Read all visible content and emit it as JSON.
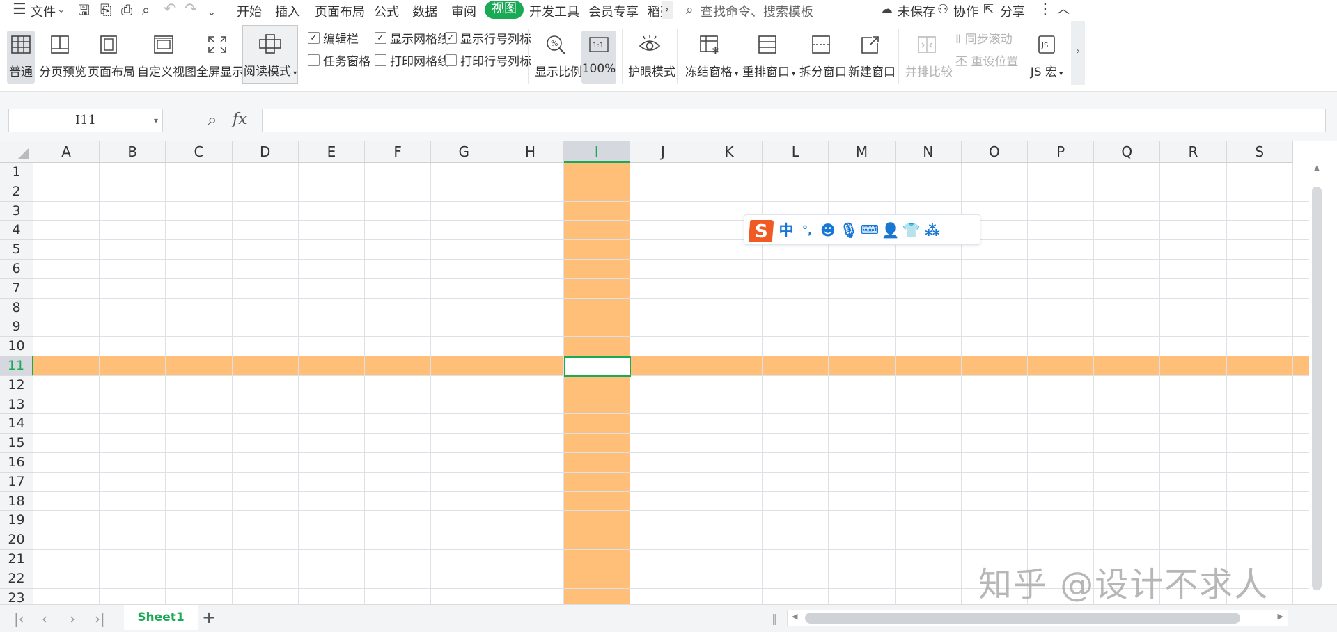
{
  "menubar": {
    "file_label": "文件",
    "tabs": [
      "开始",
      "插入",
      "页面布局",
      "公式",
      "数据",
      "审阅",
      "视图",
      "开发工具",
      "会员专享",
      "稻壳"
    ],
    "active_tab": "视图",
    "search_placeholder": "查找命令、搜索模板",
    "unsaved_label": "未保存",
    "collab_label": "协作",
    "share_label": "分享"
  },
  "ribbon": {
    "normal": "普通",
    "page_break_preview": "分页预览",
    "page_layout": "页面布局",
    "custom_view": "自定义视图",
    "fullscreen": "全屏显示",
    "reading_mode": "阅读模式",
    "edit_bar": "编辑栏",
    "task_pane": "任务窗格",
    "show_gridlines": "显示网格线",
    "print_gridlines": "打印网格线",
    "show_headings": "显示行号列标",
    "print_headings": "打印行号列标",
    "zoom": "显示比例",
    "zoom_100": "100%",
    "eye_protection": "护眼模式",
    "freeze_panes": "冻结窗格",
    "arrange_windows": "重排窗口",
    "split_window": "拆分窗口",
    "new_window": "新建窗口",
    "side_by_side": "并排比较",
    "sync_scroll": "同步滚动",
    "reset_position": "重设位置",
    "js_macro": "JS 宏",
    "checkbox_states": {
      "edit_bar": true,
      "task_pane": false,
      "show_gridlines": true,
      "print_gridlines": false,
      "show_headings": true,
      "print_headings": false
    }
  },
  "formula_bar": {
    "cell_ref": "I11",
    "fx_label": "fx",
    "formula": ""
  },
  "sheet": {
    "columns": [
      "A",
      "B",
      "C",
      "D",
      "E",
      "F",
      "G",
      "H",
      "I",
      "J",
      "K",
      "L",
      "M",
      "N",
      "O",
      "P",
      "Q",
      "R",
      "S"
    ],
    "rows": [
      "1",
      "2",
      "3",
      "4",
      "5",
      "6",
      "7",
      "8",
      "9",
      "10",
      "11",
      "12",
      "13",
      "14",
      "15",
      "16",
      "17",
      "18",
      "19",
      "20",
      "21",
      "22",
      "23"
    ],
    "active_column": "I",
    "active_row": "11",
    "highlight_color": "#ffbf78",
    "accent_color": "#1aaa55"
  },
  "ime_toolbar": {
    "mode_label": "中",
    "punct_label": "°,"
  },
  "sheet_tabs": {
    "tabs": [
      "Sheet1"
    ],
    "add_label": "+"
  },
  "watermark": "知乎 @设计不求人"
}
